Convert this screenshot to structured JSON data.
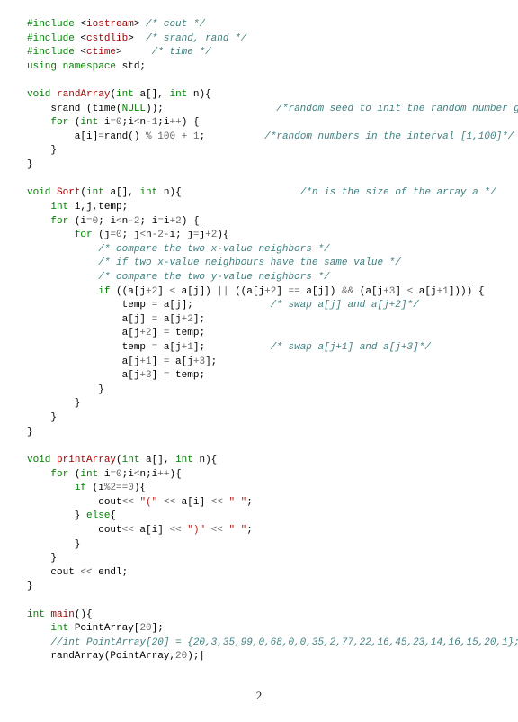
{
  "page_number": "2",
  "lines": [
    [
      [
        "kw",
        "#include "
      ],
      [
        "",
        "<"
      ],
      [
        "fn",
        "iostream"
      ],
      [
        "",
        "> "
      ],
      [
        "com",
        "/* cout */"
      ]
    ],
    [
      [
        "kw",
        "#include "
      ],
      [
        "",
        "<"
      ],
      [
        "fn",
        "cstdlib"
      ],
      [
        "",
        ">  "
      ],
      [
        "com",
        "/* srand, rand */"
      ]
    ],
    [
      [
        "kw",
        "#include "
      ],
      [
        "",
        "<"
      ],
      [
        "fn",
        "ctime"
      ],
      [
        "",
        ">     "
      ],
      [
        "com",
        "/* time */"
      ]
    ],
    [
      [
        "kw",
        "using namespace"
      ],
      [
        "",
        " std;"
      ]
    ],
    [
      [
        "",
        ""
      ]
    ],
    [
      [
        "type",
        "void"
      ],
      [
        "",
        " "
      ],
      [
        "fn",
        "randArray"
      ],
      [
        "",
        "("
      ],
      [
        "type",
        "int"
      ],
      [
        "",
        " a[], "
      ],
      [
        "type",
        "int"
      ],
      [
        "",
        " n){"
      ]
    ],
    [
      [
        "",
        "    srand (time("
      ],
      [
        "null",
        "NULL"
      ],
      [
        "",
        "));                   "
      ],
      [
        "com",
        "/*random seed to init the random number generator*/"
      ]
    ],
    [
      [
        "",
        "    "
      ],
      [
        "kw",
        "for"
      ],
      [
        "",
        " ("
      ],
      [
        "type",
        "int"
      ],
      [
        "",
        " i"
      ],
      [
        "op",
        "="
      ],
      [
        "num",
        "0"
      ],
      [
        "",
        ";i"
      ],
      [
        "op",
        "<"
      ],
      [
        "",
        "n"
      ],
      [
        "op",
        "-"
      ],
      [
        "num",
        "1"
      ],
      [
        "",
        ";i"
      ],
      [
        "op",
        "++"
      ],
      [
        "",
        ") {"
      ]
    ],
    [
      [
        "",
        "        a[i]"
      ],
      [
        "op",
        "="
      ],
      [
        "",
        "rand() "
      ],
      [
        "op",
        "%"
      ],
      [
        "",
        " "
      ],
      [
        "num",
        "100"
      ],
      [
        "",
        " "
      ],
      [
        "op",
        "+"
      ],
      [
        "",
        " "
      ],
      [
        "num",
        "1"
      ],
      [
        "",
        ";          "
      ],
      [
        "com",
        "/*random numbers in the interval [1,100]*/"
      ]
    ],
    [
      [
        "",
        "    }"
      ]
    ],
    [
      [
        "",
        "}"
      ]
    ],
    [
      [
        "",
        ""
      ]
    ],
    [
      [
        "type",
        "void"
      ],
      [
        "",
        " "
      ],
      [
        "fn",
        "Sort"
      ],
      [
        "",
        "("
      ],
      [
        "type",
        "int"
      ],
      [
        "",
        " a[], "
      ],
      [
        "type",
        "int"
      ],
      [
        "",
        " n){                    "
      ],
      [
        "com",
        "/*n is the size of the array a */"
      ]
    ],
    [
      [
        "",
        "    "
      ],
      [
        "type",
        "int"
      ],
      [
        "",
        " i,j,temp;"
      ]
    ],
    [
      [
        "",
        "    "
      ],
      [
        "kw",
        "for"
      ],
      [
        "",
        " (i"
      ],
      [
        "op",
        "="
      ],
      [
        "num",
        "0"
      ],
      [
        "",
        ";"
      ],
      [
        "",
        " i"
      ],
      [
        "op",
        "<"
      ],
      [
        "",
        "n"
      ],
      [
        "op",
        "-"
      ],
      [
        "num",
        "2"
      ],
      [
        "",
        ";"
      ],
      [
        "",
        " i"
      ],
      [
        "op",
        "="
      ],
      [
        "",
        "i"
      ],
      [
        "op",
        "+"
      ],
      [
        "num",
        "2"
      ],
      [
        "",
        ") {"
      ]
    ],
    [
      [
        "",
        "        "
      ],
      [
        "kw",
        "for"
      ],
      [
        "",
        " (j"
      ],
      [
        "op",
        "="
      ],
      [
        "num",
        "0"
      ],
      [
        "",
        ";"
      ],
      [
        "",
        " j"
      ],
      [
        "op",
        "<"
      ],
      [
        "",
        "n"
      ],
      [
        "op",
        "-"
      ],
      [
        "num",
        "2"
      ],
      [
        "op",
        "-"
      ],
      [
        "",
        "i;"
      ],
      [
        "",
        " j"
      ],
      [
        "op",
        "="
      ],
      [
        "",
        "j"
      ],
      [
        "op",
        "+"
      ],
      [
        "num",
        "2"
      ],
      [
        "",
        "){"
      ]
    ],
    [
      [
        "",
        "            "
      ],
      [
        "com",
        "/* compare the two x-value neighbors */"
      ]
    ],
    [
      [
        "",
        "            "
      ],
      [
        "com",
        "/* if two x-value neighbours have the same value */"
      ]
    ],
    [
      [
        "",
        "            "
      ],
      [
        "com",
        "/* compare the two y-value neighbors */"
      ]
    ],
    [
      [
        "",
        "            "
      ],
      [
        "kw",
        "if"
      ],
      [
        "",
        " ((a[j"
      ],
      [
        "op",
        "+"
      ],
      [
        "num",
        "2"
      ],
      [
        "",
        "] "
      ],
      [
        "op",
        "<"
      ],
      [
        "",
        " a[j]) "
      ],
      [
        "op",
        "||"
      ],
      [
        "",
        " ((a[j"
      ],
      [
        "op",
        "+"
      ],
      [
        "num",
        "2"
      ],
      [
        "",
        "] "
      ],
      [
        "op",
        "=="
      ],
      [
        "",
        " a[j]) "
      ],
      [
        "op",
        "&&"
      ],
      [
        "",
        " (a[j"
      ],
      [
        "op",
        "+"
      ],
      [
        "num",
        "3"
      ],
      [
        "",
        "] "
      ],
      [
        "op",
        "<"
      ],
      [
        "",
        " a[j"
      ],
      [
        "op",
        "+"
      ],
      [
        "num",
        "1"
      ],
      [
        "",
        "]))) {"
      ]
    ],
    [
      [
        "",
        "                temp "
      ],
      [
        "op",
        "="
      ],
      [
        "",
        " a[j];             "
      ],
      [
        "com",
        "/* swap a[j] and a[j+2]*/"
      ]
    ],
    [
      [
        "",
        "                a[j] "
      ],
      [
        "op",
        "="
      ],
      [
        "",
        " a[j"
      ],
      [
        "op",
        "+"
      ],
      [
        "num",
        "2"
      ],
      [
        "",
        "];"
      ]
    ],
    [
      [
        "",
        "                a[j"
      ],
      [
        "op",
        "+"
      ],
      [
        "num",
        "2"
      ],
      [
        "",
        "] "
      ],
      [
        "op",
        "="
      ],
      [
        "",
        " temp;"
      ]
    ],
    [
      [
        "",
        "                temp "
      ],
      [
        "op",
        "="
      ],
      [
        "",
        " a[j"
      ],
      [
        "op",
        "+"
      ],
      [
        "num",
        "1"
      ],
      [
        "",
        "];           "
      ],
      [
        "com",
        "/* swap a[j+1] and a[j+3]*/"
      ]
    ],
    [
      [
        "",
        "                a[j"
      ],
      [
        "op",
        "+"
      ],
      [
        "num",
        "1"
      ],
      [
        "",
        "] "
      ],
      [
        "op",
        "="
      ],
      [
        "",
        " a[j"
      ],
      [
        "op",
        "+"
      ],
      [
        "num",
        "3"
      ],
      [
        "",
        "];"
      ]
    ],
    [
      [
        "",
        "                a[j"
      ],
      [
        "op",
        "+"
      ],
      [
        "num",
        "3"
      ],
      [
        "",
        "] "
      ],
      [
        "op",
        "="
      ],
      [
        "",
        " temp;"
      ]
    ],
    [
      [
        "",
        "            }"
      ]
    ],
    [
      [
        "",
        "        }"
      ]
    ],
    [
      [
        "",
        "    }"
      ]
    ],
    [
      [
        "",
        "}"
      ]
    ],
    [
      [
        "",
        ""
      ]
    ],
    [
      [
        "type",
        "void"
      ],
      [
        "",
        " "
      ],
      [
        "fn",
        "printArray"
      ],
      [
        "",
        "("
      ],
      [
        "type",
        "int"
      ],
      [
        "",
        " a[], "
      ],
      [
        "type",
        "int"
      ],
      [
        "",
        " n){"
      ]
    ],
    [
      [
        "",
        "    "
      ],
      [
        "kw",
        "for"
      ],
      [
        "",
        " ("
      ],
      [
        "type",
        "int"
      ],
      [
        "",
        " i"
      ],
      [
        "op",
        "="
      ],
      [
        "num",
        "0"
      ],
      [
        "",
        ";i"
      ],
      [
        "op",
        "<"
      ],
      [
        "",
        "n;i"
      ],
      [
        "op",
        "++"
      ],
      [
        "",
        "){"
      ]
    ],
    [
      [
        "",
        "        "
      ],
      [
        "kw",
        "if"
      ],
      [
        "",
        " (i"
      ],
      [
        "op",
        "%"
      ],
      [
        "num",
        "2"
      ],
      [
        "op",
        "=="
      ],
      [
        "num",
        "0"
      ],
      [
        "",
        "){"
      ]
    ],
    [
      [
        "",
        "            cout"
      ],
      [
        "op",
        "<<"
      ],
      [
        "",
        " "
      ],
      [
        "str",
        "\"(\""
      ],
      [
        "",
        " "
      ],
      [
        "op",
        "<<"
      ],
      [
        "",
        " a[i] "
      ],
      [
        "op",
        "<<"
      ],
      [
        "",
        " "
      ],
      [
        "str",
        "\" \""
      ],
      [
        "",
        ";"
      ]
    ],
    [
      [
        "",
        "        } "
      ],
      [
        "kw",
        "else"
      ],
      [
        "",
        "{"
      ]
    ],
    [
      [
        "",
        "            cout"
      ],
      [
        "op",
        "<<"
      ],
      [
        "",
        " a[i] "
      ],
      [
        "op",
        "<<"
      ],
      [
        "",
        " "
      ],
      [
        "str",
        "\")\""
      ],
      [
        "",
        " "
      ],
      [
        "op",
        "<<"
      ],
      [
        "",
        " "
      ],
      [
        "str",
        "\" \""
      ],
      [
        "",
        ";"
      ]
    ],
    [
      [
        "",
        "        }"
      ]
    ],
    [
      [
        "",
        "    }"
      ]
    ],
    [
      [
        "",
        "    cout "
      ],
      [
        "op",
        "<<"
      ],
      [
        "",
        " endl;"
      ]
    ],
    [
      [
        "",
        "}"
      ]
    ],
    [
      [
        "",
        ""
      ]
    ],
    [
      [
        "type",
        "int"
      ],
      [
        "",
        " "
      ],
      [
        "fn",
        "main"
      ],
      [
        "",
        "(){"
      ]
    ],
    [
      [
        "",
        "    "
      ],
      [
        "type",
        "int"
      ],
      [
        "",
        " PointArray["
      ],
      [
        "num",
        "20"
      ],
      [
        "",
        "];"
      ]
    ],
    [
      [
        "",
        "    "
      ],
      [
        "com",
        "//int PointArray[20] = {20,3,35,99,0,68,0,0,35,2,77,22,16,45,23,14,16,15,20,1};"
      ]
    ],
    [
      [
        "",
        "    randArray(PointArray,"
      ],
      [
        "num",
        "20"
      ],
      [
        "",
        ");|"
      ]
    ]
  ]
}
